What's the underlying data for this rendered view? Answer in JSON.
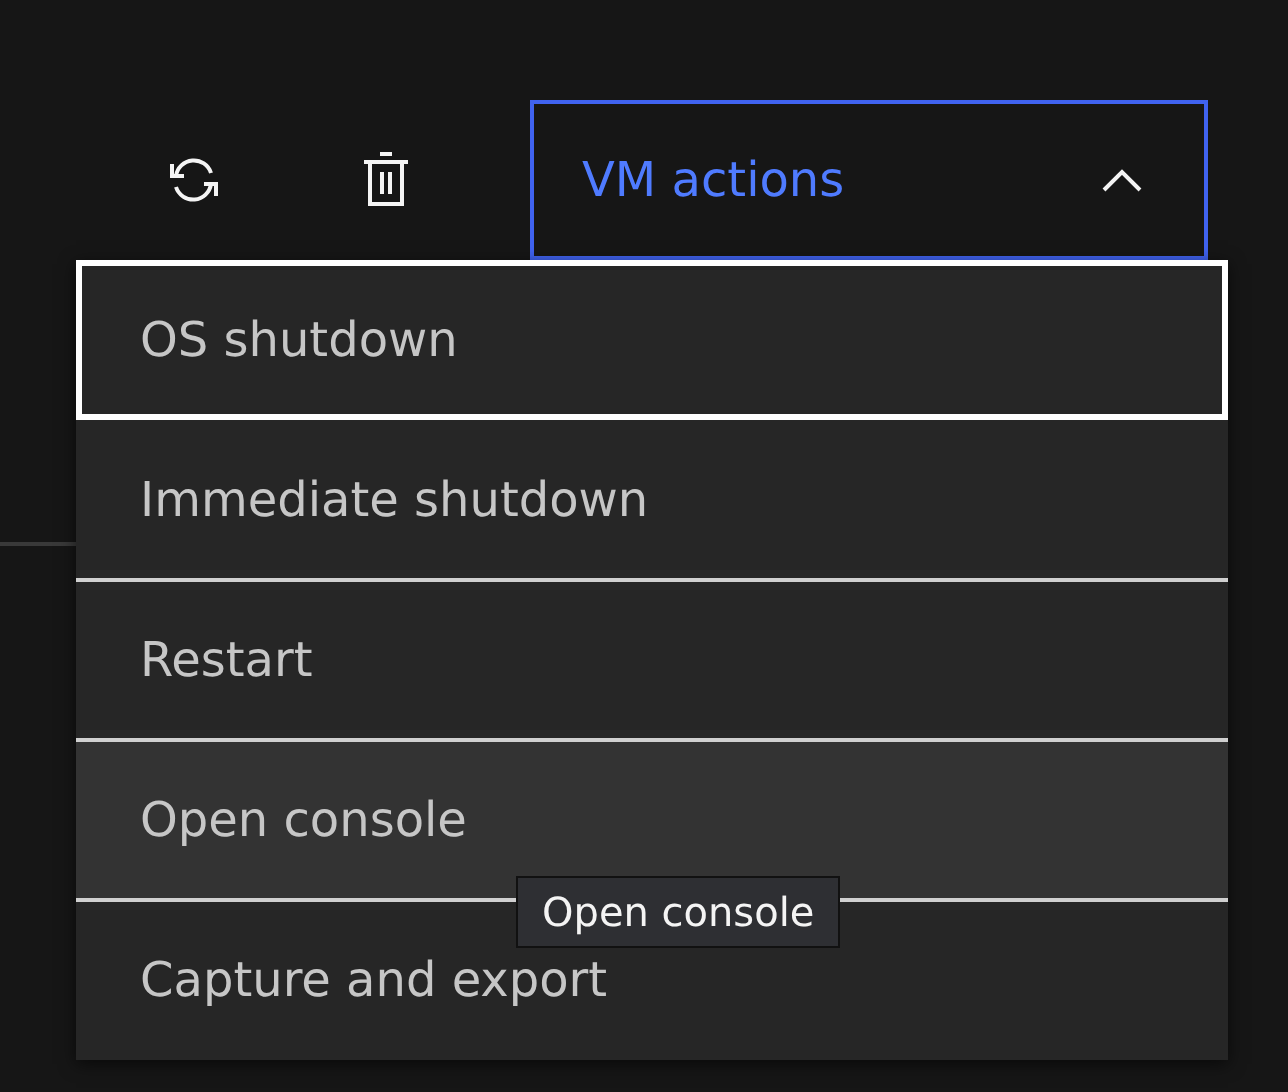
{
  "toolbar": {
    "buttons": [
      {
        "kind": "refresh"
      },
      {
        "kind": "delete"
      }
    ]
  },
  "dropdown": {
    "label": "VM actions",
    "expanded": true,
    "items": [
      {
        "label": "OS shutdown",
        "focused": true,
        "hovered": false
      },
      {
        "label": "Immediate shutdown",
        "focused": false,
        "hovered": false
      },
      {
        "label": "Restart",
        "focused": false,
        "hovered": false
      },
      {
        "label": "Open console",
        "focused": false,
        "hovered": true
      },
      {
        "label": "Capture and export",
        "focused": false,
        "hovered": false
      }
    ]
  },
  "tooltip": {
    "text": "Open console"
  }
}
